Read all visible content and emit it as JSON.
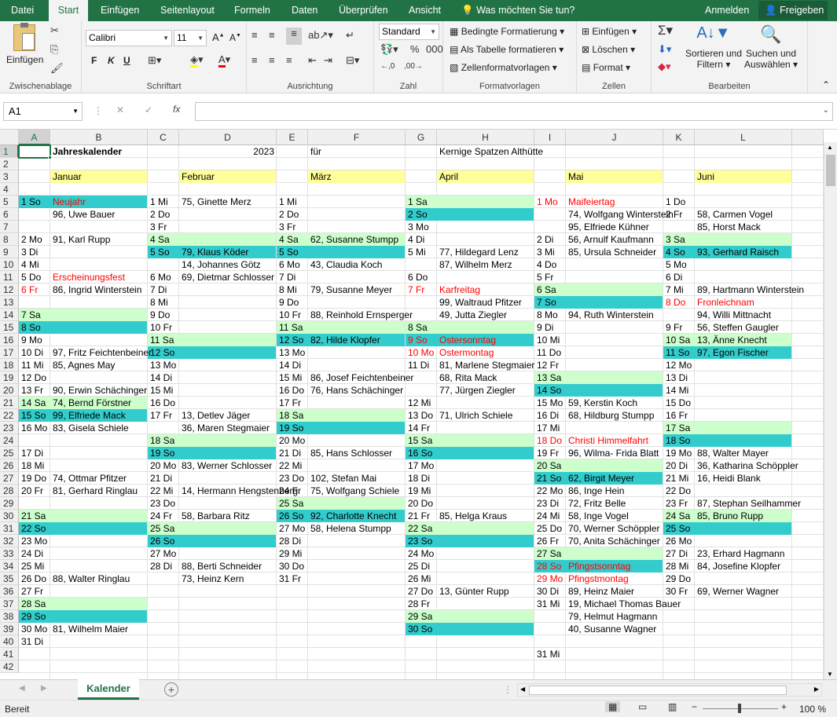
{
  "tabs": [
    "Datei",
    "Start",
    "Einfügen",
    "Seitenlayout",
    "Formeln",
    "Daten",
    "Überprüfen",
    "Ansicht"
  ],
  "tellme": "Was möchten Sie tun?",
  "account": {
    "signin": "Anmelden",
    "share": "Freigeben"
  },
  "ribbon": {
    "clipboard": {
      "paste": "Einfügen",
      "label": "Zwischenablage"
    },
    "font": {
      "name": "Calibri",
      "size": "11",
      "bold": "F",
      "italic": "K",
      "underline": "U",
      "label": "Schriftart"
    },
    "alignment": {
      "label": "Ausrichtung"
    },
    "number": {
      "format": "Standard",
      "label": "Zahl"
    },
    "styles": {
      "conditional": "Bedingte Formatierung",
      "table": "Als Tabelle formatieren",
      "cellstyles": "Zellenformatvorlagen",
      "label": "Formatvorlagen"
    },
    "cells": {
      "insert": "Einfügen",
      "delete": "Löschen",
      "format": "Format",
      "label": "Zellen"
    },
    "editing": {
      "sort1": "Sortieren und",
      "sort2": "Filtern",
      "find1": "Suchen und",
      "find2": "Auswählen",
      "label": "Bearbeiten"
    }
  },
  "namebox": "A1",
  "formula": "",
  "colors": {
    "weekend_sa": "#ccffcc",
    "weekend_so": "#33cccc",
    "month_header": "#ffff99",
    "holiday_text": "#ff0000",
    "accent": "#217346"
  },
  "columns": [
    "A",
    "B",
    "C",
    "D",
    "E",
    "F",
    "G",
    "H",
    "I",
    "J",
    "K",
    "L"
  ],
  "rows": [
    1,
    2,
    3,
    4,
    5,
    6,
    7,
    8,
    9,
    10,
    11,
    12,
    13,
    14,
    15,
    16,
    17,
    18,
    19,
    20,
    21,
    22,
    23,
    24,
    25,
    26,
    27,
    28,
    29,
    30,
    31,
    32,
    33,
    34,
    35,
    36,
    37,
    38,
    39,
    40,
    41,
    42
  ],
  "header": {
    "title": "Jahreskalender",
    "year": "2023",
    "fuer": "für",
    "club": "Kernige Spatzen Althütte"
  },
  "months": [
    "Januar",
    "Februar",
    "März",
    "April",
    "Mai",
    "Juni"
  ],
  "calendar": [
    {
      "days": [
        [
          1,
          "1 So",
          "Neujahr",
          1
        ],
        [
          2,
          "",
          ""
        ],
        [
          3,
          "",
          ""
        ],
        [
          4,
          "",
          ""
        ],
        [
          5,
          "",
          ""
        ],
        [
          6,
          "",
          ""
        ],
        [
          7,
          "",
          "96, Uwe Bauer"
        ],
        [
          8,
          "2 Mo",
          ""
        ],
        [
          9,
          "3 Di",
          "91, Karl Rupp"
        ],
        [
          10,
          "4 Mi",
          ""
        ],
        [
          11,
          "5 Do",
          ""
        ],
        [
          12,
          "6 Fr",
          "Erscheinungsfest",
          1
        ],
        [
          13,
          "",
          "86, Ingrid Winterstein"
        ],
        [
          14,
          "7 Sa",
          ""
        ],
        [
          15,
          "8 So",
          ""
        ],
        [
          16,
          "9 Mo",
          ""
        ],
        [
          17,
          "10 Di",
          ""
        ],
        [
          18,
          "11 Mi",
          "97, Fritz Feichtenbeiner"
        ],
        [
          19,
          "12 Do",
          "85, Agnes May"
        ],
        [
          20,
          "13 Fr",
          ""
        ],
        [
          21,
          "14 Di",
          ""
        ]
      ]
    },
    {
      "days": []
    }
  ],
  "col_a": [
    [
      "5",
      "1 So",
      0
    ],
    [
      "8",
      "2 Mo",
      0
    ],
    [
      "9",
      "3 Di",
      0
    ],
    [
      "10",
      "4 Mi",
      0
    ],
    [
      "11",
      "5 Do",
      0
    ],
    [
      "12",
      "6 Fr",
      1
    ],
    [
      "14",
      "7 Sa",
      0
    ],
    [
      "15",
      "8 So",
      0
    ],
    [
      "16",
      "9 Mo",
      0
    ],
    [
      "17",
      "10 Di",
      0
    ],
    [
      "18",
      "11 Mi",
      0
    ],
    [
      "19",
      "12 Do",
      0
    ],
    [
      "20",
      "13 Fr",
      0
    ],
    [
      "21",
      "14 Sa",
      0
    ],
    [
      "22",
      "15 So",
      0
    ],
    [
      "23",
      "16 Mo",
      0
    ],
    [
      "25",
      "17 Di",
      0
    ],
    [
      "26",
      "18 Mi",
      0
    ],
    [
      "27",
      "19 Do",
      0
    ],
    [
      "28",
      "20 Fr",
      0
    ],
    [
      "30",
      "21 Sa",
      0
    ],
    [
      "31",
      "22 So",
      0
    ],
    [
      "32",
      "23 Mo",
      0
    ],
    [
      "33",
      "24 Di",
      0
    ],
    [
      "34",
      "25 Mi",
      0
    ],
    [
      "35",
      "26 Do",
      0
    ],
    [
      "36",
      "27 Fr",
      0
    ],
    [
      "37",
      "28 Sa",
      0
    ],
    [
      "38",
      "29 So",
      0
    ],
    [
      "39",
      "30 Mo",
      0
    ],
    [
      "40",
      "31 Di",
      0
    ]
  ],
  "col_b": [
    [
      "5",
      "Neujahr",
      1
    ],
    [
      "6",
      "96, Uwe Bauer",
      0
    ],
    [
      "8",
      "91, Karl Rupp",
      0
    ],
    [
      "11",
      "Erscheinungsfest",
      1
    ],
    [
      "12",
      "86, Ingrid Winterstein",
      0
    ],
    [
      "17",
      "97, Fritz Feichtenbeiner",
      0
    ],
    [
      "18",
      "85, Agnes May",
      0
    ],
    [
      "20",
      "90, Erwin Schächinger",
      0
    ],
    [
      "21",
      "74, Bernd Förstner",
      0
    ],
    [
      "22",
      "99, Elfriede Mack",
      0
    ],
    [
      "23",
      "83, Gisela Schiele",
      0
    ],
    [
      "27",
      "74, Ottmar Pfitzer",
      0
    ],
    [
      "28",
      "81, Gerhard Ringlau",
      0
    ],
    [
      "35",
      "88, Walter Ringlau",
      0
    ],
    [
      "39",
      "81, Wilhelm Maier",
      0
    ]
  ],
  "col_c": [
    [
      "5",
      "1 Mi"
    ],
    [
      "6",
      "2 Do"
    ],
    [
      "7",
      "3 Fr"
    ],
    [
      "8",
      "4 Sa"
    ],
    [
      "9",
      "5 So"
    ],
    [
      "11",
      "6 Mo"
    ],
    [
      "12",
      "7 Di"
    ],
    [
      "13",
      "8 Mi"
    ],
    [
      "14",
      "9 Do"
    ],
    [
      "15",
      "10 Fr"
    ],
    [
      "16",
      "11 Sa"
    ],
    [
      "17",
      "12 So"
    ],
    [
      "18",
      "13 Mo"
    ],
    [
      "19",
      "14 Di"
    ],
    [
      "20",
      "15 Mi"
    ],
    [
      "21",
      "16 Do"
    ],
    [
      "22",
      "17 Fr"
    ],
    [
      "24",
      "18 Sa"
    ],
    [
      "25",
      "19 So"
    ],
    [
      "26",
      "20 Mo"
    ],
    [
      "27",
      "21 Di"
    ],
    [
      "28",
      "22 Mi"
    ],
    [
      "29",
      "23 Do"
    ],
    [
      "30",
      "24 Fr"
    ],
    [
      "31",
      "25 Sa"
    ],
    [
      "32",
      "26 So"
    ],
    [
      "33",
      "27 Mo"
    ],
    [
      "34",
      "28 Di"
    ]
  ],
  "col_d": [
    [
      "5",
      "75, Ginette Merz"
    ],
    [
      "9",
      "79, Klaus Köder"
    ],
    [
      "10",
      "14, Johannes Götz"
    ],
    [
      "11",
      "69, Dietmar Schlosser"
    ],
    [
      "22",
      "13, Detlev Jäger"
    ],
    [
      "23",
      "36, Maren Stegmaier"
    ],
    [
      "26",
      "83, Werner Schlosser"
    ],
    [
      "28",
      "14, Hermann Hengstenberg"
    ],
    [
      "30",
      "58, Barbara Ritz"
    ],
    [
      "34",
      "88, Berti Schneider"
    ],
    [
      "35",
      "73, Heinz Kern"
    ]
  ],
  "col_e": [
    [
      "5",
      "1 Mi"
    ],
    [
      "6",
      "2 Do"
    ],
    [
      "7",
      "3 Fr"
    ],
    [
      "8",
      "4 Sa"
    ],
    [
      "9",
      "5 So"
    ],
    [
      "10",
      "6 Mo"
    ],
    [
      "11",
      "7 Di"
    ],
    [
      "12",
      "8 Mi"
    ],
    [
      "13",
      "9 Do"
    ],
    [
      "14",
      "10 Fr"
    ],
    [
      "15",
      "11 Sa"
    ],
    [
      "16",
      "12 So"
    ],
    [
      "17",
      "13 Mo"
    ],
    [
      "18",
      "14 Di"
    ],
    [
      "19",
      "15 Mi"
    ],
    [
      "20",
      "16 Do"
    ],
    [
      "21",
      "17 Fr"
    ],
    [
      "22",
      "18 Sa"
    ],
    [
      "23",
      "19 So"
    ],
    [
      "24",
      "20 Mo"
    ],
    [
      "25",
      "21 Di"
    ],
    [
      "26",
      "22 Mi"
    ],
    [
      "27",
      "23 Do"
    ],
    [
      "28",
      "24 Fr"
    ],
    [
      "29",
      "25 Sa"
    ],
    [
      "30",
      "26 So"
    ],
    [
      "31",
      "27 Mo"
    ],
    [
      "32",
      "28 Di"
    ],
    [
      "33",
      "29 Mi"
    ],
    [
      "34",
      "30 Do"
    ],
    [
      "35",
      "31 Fr"
    ]
  ],
  "col_f": [
    [
      "8",
      "62, Susanne  Stumpp"
    ],
    [
      "10",
      "43, Claudia Koch"
    ],
    [
      "12",
      "79, Susanne Meyer"
    ],
    [
      "14",
      "88, Reinhold Ernsperger"
    ],
    [
      "16",
      "82, Hilde Klopfer"
    ],
    [
      "19",
      "86, Josef Feichtenbeiner"
    ],
    [
      "20",
      "76, Hans Schächinger"
    ],
    [
      "25",
      "85, Hans Schlosser"
    ],
    [
      "27",
      "102, Stefan Mai"
    ],
    [
      "28",
      "75, Wolfgang Schiele"
    ],
    [
      "30",
      "92, Charlotte  Knecht"
    ],
    [
      "31",
      "58, Helena Stumpp"
    ]
  ],
  "col_g": [
    [
      "5",
      "1 Sa",
      0
    ],
    [
      "6",
      "2 So",
      0
    ],
    [
      "7",
      "3 Mo",
      0
    ],
    [
      "8",
      "4 Di",
      0
    ],
    [
      "9",
      "5 Mi",
      0
    ],
    [
      "11",
      "6 Do",
      0
    ],
    [
      "12",
      "7 Fr",
      1
    ],
    [
      "15",
      "8 Sa",
      0
    ],
    [
      "16",
      "9 So",
      1
    ],
    [
      "17",
      "10 Mo",
      1
    ],
    [
      "18",
      "11 Di",
      0
    ],
    [
      "21",
      "12 Mi",
      0
    ],
    [
      "22",
      "13 Do",
      0
    ],
    [
      "23",
      "14 Fr",
      0
    ],
    [
      "24",
      "15 Sa",
      0
    ],
    [
      "25",
      "16 So",
      0
    ],
    [
      "26",
      "17 Mo",
      0
    ],
    [
      "27",
      "18 Di",
      0
    ],
    [
      "28",
      "19 Mi",
      0
    ],
    [
      "29",
      "20 Do",
      0
    ],
    [
      "30",
      "21 Fr",
      0
    ],
    [
      "31",
      "22 Sa",
      0
    ],
    [
      "32",
      "23 So",
      0
    ],
    [
      "33",
      "24 Mo",
      0
    ],
    [
      "34",
      "25 Di",
      0
    ],
    [
      "35",
      "26 Mi",
      0
    ],
    [
      "36",
      "27 Do",
      0
    ],
    [
      "37",
      "28 Fr",
      0
    ],
    [
      "38",
      "29 Sa",
      0
    ],
    [
      "39",
      "30 So",
      0
    ]
  ],
  "col_h": [
    [
      "9",
      "77, Hildegard Lenz",
      0
    ],
    [
      "10",
      "87, Wilhelm Merz",
      0
    ],
    [
      "12",
      "Karfreitag",
      1
    ],
    [
      "13",
      "99, Waltraud Pfitzer",
      0
    ],
    [
      "14",
      "49, Jutta Ziegler",
      0
    ],
    [
      "16",
      "Ostersonntag",
      1
    ],
    [
      "17",
      "Ostermontag",
      1
    ],
    [
      "18",
      "81, Marlene Stegmaier",
      0
    ],
    [
      "19",
      "68, Rita Mack",
      0
    ],
    [
      "20",
      "77, Jürgen Ziegler",
      0
    ],
    [
      "22",
      "71, Ulrich Schiele",
      0
    ],
    [
      "30",
      "85, Helga Kraus",
      0
    ],
    [
      "36",
      "13, Günter Rupp",
      0
    ]
  ],
  "col_i": [
    [
      "5",
      "1 Mo",
      1
    ],
    [
      "8",
      "2 Di",
      0
    ],
    [
      "9",
      "3 Mi",
      0
    ],
    [
      "10",
      "4 Do",
      0
    ],
    [
      "11",
      "5 Fr",
      0
    ],
    [
      "12",
      "6 Sa",
      0
    ],
    [
      "13",
      "7 So",
      0
    ],
    [
      "14",
      "8 Mo",
      0
    ],
    [
      "15",
      "9 Di",
      0
    ],
    [
      "16",
      "10 Mi",
      0
    ],
    [
      "17",
      "11 Do",
      0
    ],
    [
      "18",
      "12 Fr",
      0
    ],
    [
      "19",
      "13 Sa",
      0
    ],
    [
      "20",
      "14 So",
      0
    ],
    [
      "21",
      "15 Mo",
      0
    ],
    [
      "22",
      "16 Di",
      0
    ],
    [
      "23",
      "17 Mi",
      0
    ],
    [
      "24",
      "18 Do",
      1
    ],
    [
      "25",
      "19 Fr",
      0
    ],
    [
      "26",
      "20 Sa",
      0
    ],
    [
      "27",
      "21 So",
      0
    ],
    [
      "28",
      "22 Mo",
      0
    ],
    [
      "29",
      "23 Di",
      0
    ],
    [
      "30",
      "24 Mi",
      0
    ],
    [
      "31",
      "25 Do",
      0
    ],
    [
      "32",
      "26 Fr",
      0
    ],
    [
      "33",
      "27 Sa",
      0
    ],
    [
      "34",
      "28 So",
      1
    ],
    [
      "35",
      "29 Mo",
      1
    ],
    [
      "36",
      "30 Di",
      0
    ],
    [
      "37",
      "31 Mi",
      0
    ]
  ],
  "col_j": [
    [
      "5",
      "Maifeiertag",
      1
    ],
    [
      "6",
      "74, Wolfgang Winterstein",
      0
    ],
    [
      "7",
      "95, Elfriede Kühner",
      0
    ],
    [
      "8",
      "56, Arnulf Kaufmann",
      0
    ],
    [
      "9",
      "85, Ursula Schneider",
      0
    ],
    [
      "14",
      "94, Ruth Winterstein",
      0
    ],
    [
      "21",
      "59, Kerstin Koch",
      0
    ],
    [
      "22",
      "68, Hildburg Stumpp",
      0
    ],
    [
      "24",
      "Christi Himmelfahrt",
      1
    ],
    [
      "25",
      "96, Wilma- Frida   Blatt",
      0
    ],
    [
      "27",
      "62, Birgit Meyer",
      0
    ],
    [
      "28",
      "86, Inge Hein",
      0
    ],
    [
      "29",
      "72, Fritz Belle",
      0
    ],
    [
      "30",
      "58, Inge Vogel",
      0
    ],
    [
      "31",
      "70, Werner Schöppler",
      0
    ],
    [
      "32",
      "70, Anita Schächinger",
      0
    ],
    [
      "34",
      "Pfingstsonntag",
      1
    ],
    [
      "35",
      "Pfingstmontag",
      1
    ],
    [
      "36",
      "89, Heinz Maier",
      0
    ],
    [
      "37",
      "19, Michael Thomas Bauer",
      0
    ],
    [
      "38",
      "79, Helmut Hagmann",
      0
    ],
    [
      "39",
      "40, Susanne Wagner",
      0
    ]
  ],
  "col_k": [
    [
      "5",
      "1 Do",
      0
    ],
    [
      "6",
      "2 Fr",
      0
    ],
    [
      "8",
      "3 Sa",
      0
    ],
    [
      "9",
      "4 So",
      0
    ],
    [
      "10",
      "5 Mo",
      0
    ],
    [
      "11",
      "6 Di",
      0
    ],
    [
      "12",
      "7 Mi",
      0
    ],
    [
      "13",
      "8 Do",
      1
    ],
    [
      "15",
      "9 Fr",
      0
    ],
    [
      "16",
      "10 Sa",
      0
    ],
    [
      "17",
      "11 So",
      0
    ],
    [
      "18",
      "12 Mo",
      0
    ],
    [
      "19",
      "13 Di",
      0
    ],
    [
      "20",
      "14 Mi",
      0
    ],
    [
      "21",
      "15 Do",
      0
    ],
    [
      "22",
      "16 Fr",
      0
    ],
    [
      "23",
      "17 Sa",
      0
    ],
    [
      "24",
      "18 So",
      0
    ],
    [
      "25",
      "19 Mo",
      0
    ],
    [
      "26",
      "20 Di",
      0
    ],
    [
      "27",
      "21 Mi",
      0
    ],
    [
      "28",
      "22 Do",
      0
    ],
    [
      "29",
      "23 Fr",
      0
    ],
    [
      "30",
      "24 Sa",
      0
    ],
    [
      "31",
      "25 So",
      0
    ],
    [
      "32",
      "26 Mo",
      0
    ],
    [
      "33",
      "27 Di",
      0
    ],
    [
      "34",
      "28 Mi",
      0
    ],
    [
      "35",
      "29 Do",
      0
    ],
    [
      "36",
      "30 Fr",
      0
    ]
  ],
  "col_l": [
    [
      "6",
      "58, Carmen Vogel",
      0
    ],
    [
      "7",
      "85, Horst Mack",
      0
    ],
    [
      "9",
      "93, Gerhard Raisch",
      0
    ],
    [
      "12",
      "89, Hartmann Winterstein",
      0
    ],
    [
      "13",
      "Fronleichnam",
      1
    ],
    [
      "14",
      "94, Willi Mittnacht",
      0
    ],
    [
      "15",
      "56, Steffen Gaugler",
      0
    ],
    [
      "16",
      "13, Änne Knecht",
      0
    ],
    [
      "17",
      "97, Egon Fischer",
      0
    ],
    [
      "25",
      "88, Walter Mayer",
      0
    ],
    [
      "26",
      "36, Katharina Schöppler",
      0
    ],
    [
      "27",
      "16, Heidi Blank",
      0
    ],
    [
      "29",
      "87, Stephan Seilhammer",
      0
    ],
    [
      "30",
      "85, Bruno Rupp",
      0
    ],
    [
      "33",
      "23, Erhard Hagmann",
      0
    ],
    [
      "34",
      "84, Josefine Klopfer",
      0
    ],
    [
      "36",
      "69, Werner Wagner",
      0
    ]
  ],
  "col_ij_extra": [
    [
      "41",
      "31 Mi"
    ]
  ],
  "sheet_tab": "Kalender",
  "status": {
    "ready": "Bereit",
    "zoom": "100 %"
  }
}
